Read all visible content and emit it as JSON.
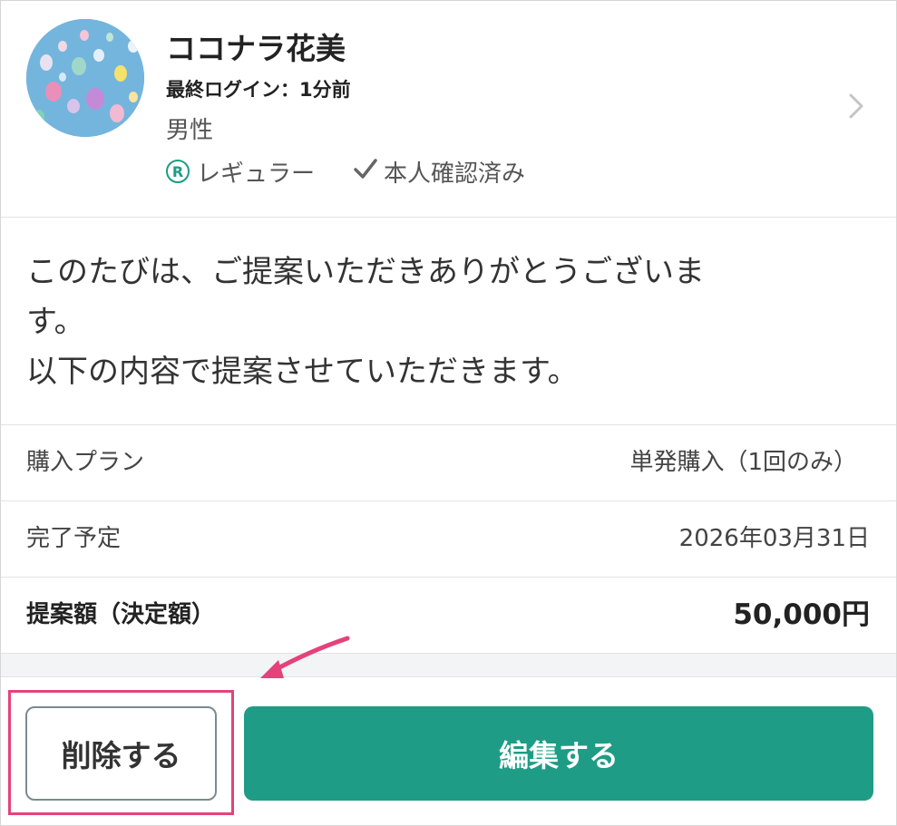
{
  "profile": {
    "name": "ココナラ花美",
    "last_login": "最終ログイン：1分前",
    "gender": "男性",
    "rank_badge_letter": "R",
    "rank_label": "レギュラー",
    "verified_label": "本人確認済み"
  },
  "message": {
    "lines": [
      "このたびは、ご提案いただきありがとうございま",
      "す。",
      "以下の内容で提案させていただきます。"
    ]
  },
  "details": {
    "plan_label": "購入プラン",
    "plan_value": "単発購入（1回のみ）",
    "due_label": "完了予定",
    "due_value": "2026年03月31日",
    "amount_label": "提案額（決定額）",
    "amount_value": "50,000円"
  },
  "actions": {
    "delete_label": "削除する",
    "edit_label": "編集する"
  },
  "colors": {
    "accent_green": "#1f9c85",
    "highlight_pink": "#e5427a",
    "border_gray": "#e3e3e3"
  },
  "icons": {
    "avatar": "balloons-photo",
    "rank": "registered-r-icon",
    "verified": "check-icon",
    "navigate": "chevron-right-icon",
    "annotation": "pink-arrow"
  }
}
